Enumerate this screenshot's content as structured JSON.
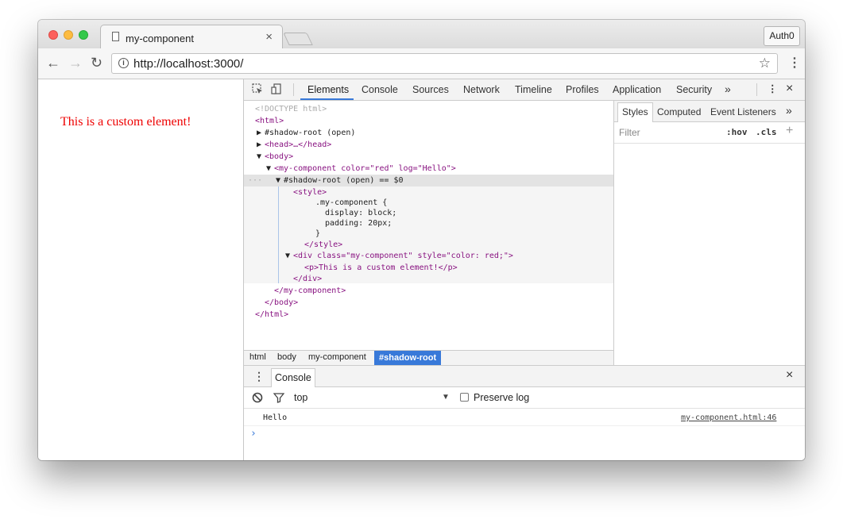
{
  "browser": {
    "tab_title": "my-component",
    "tab_close": "×",
    "profile_button": "Auth0",
    "url": "http://localhost:3000/"
  },
  "page": {
    "text": "This is a custom element!",
    "text_color": "#e00000"
  },
  "devtools": {
    "tabs": [
      "Elements",
      "Console",
      "Sources",
      "Network",
      "Timeline",
      "Profiles",
      "Application",
      "Security"
    ],
    "active_tab": "Elements",
    "more": "»",
    "close": "×",
    "dom_lines": [
      "<!DOCTYPE html>",
      "<html>",
      "#shadow-root (open)",
      "<head>…</head>",
      "<body>",
      "<my-component color=\"red\" log=\"Hello\">",
      "#shadow-root (open) == $0",
      "<style>",
      ".my-component {",
      "display: block;",
      "padding: 20px;",
      "}",
      "</style>",
      "<div class=\"my-component\" style=\"color: red;\">",
      "<p>This is a custom element!</p>",
      "</div>",
      "</my-component>",
      "</body>",
      "</html>"
    ],
    "breadcrumbs": [
      "html",
      "body",
      "my-component",
      "#shadow-root"
    ],
    "styles_tabs": [
      "Styles",
      "Computed",
      "Event Listeners"
    ],
    "styles_more": "»",
    "filter_placeholder": "Filter",
    "hov": ":hov",
    "cls": ".cls",
    "plus": "+"
  },
  "console": {
    "tab_label": "Console",
    "context": "top",
    "preserve_log": "Preserve log",
    "message": "Hello",
    "source": "my-component.html:46",
    "prompt": "›",
    "close": "×"
  },
  "colors": {
    "accent": "#3879d9",
    "tag": "#881280",
    "attribute": "#994500",
    "value": "#1a1aa6"
  }
}
